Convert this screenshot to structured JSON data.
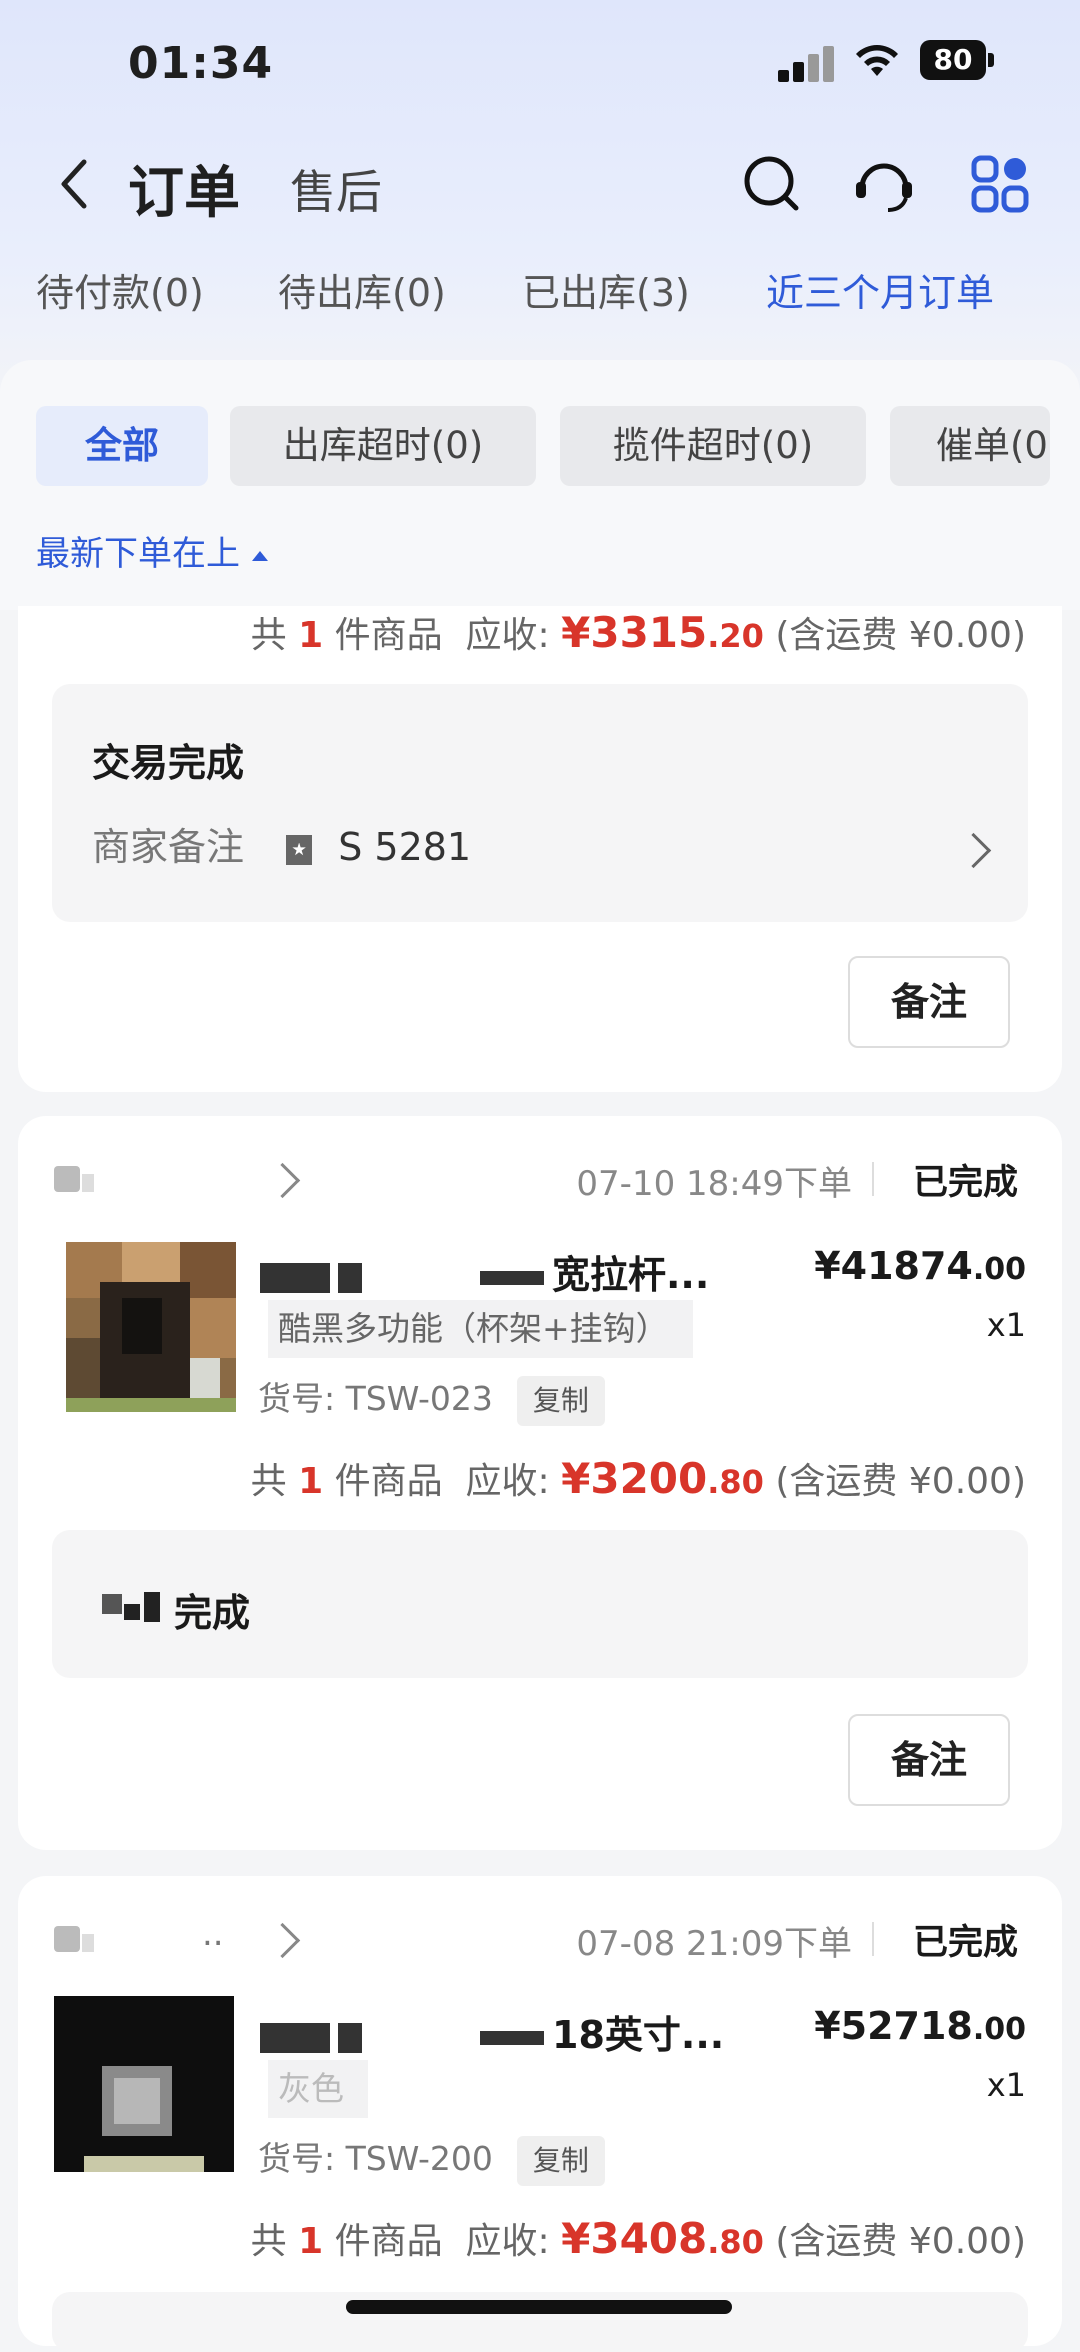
{
  "status_bar": {
    "time": "01:34",
    "battery": "80"
  },
  "header": {
    "title": "订单",
    "after_sale": "售后"
  },
  "tabs": [
    "待付款(0)",
    "待出库(0)",
    "已出库(3)",
    "近三个月订单"
  ],
  "active_tab": 3,
  "filters": [
    "全部",
    "出库超时(0)",
    "揽件超时(0)",
    "催单(0"
  ],
  "sort_label": "最新下单在上",
  "orders": [
    {
      "summary": {
        "prefix": "共",
        "count": "1",
        "unit": "件商品",
        "receivable_label": "应收:",
        "amount_int": "¥3315",
        "amount_dec": ".20",
        "shipping": "(含运费 ¥0.00)"
      },
      "status_title": "交易完成",
      "note_label": "商家备注",
      "note_value": "S        5281",
      "note_button": "备注"
    },
    {
      "shop_name": "",
      "time": "07-10 18:49下单",
      "status": "已完成",
      "product_title": "宽拉杆...",
      "price_int": "¥41874",
      "price_dec": ".00",
      "qty": "x1",
      "spec": "酷黑多功能（杯架+挂钩）",
      "sku": "货号: TSW-023",
      "copy": "复制",
      "summary": {
        "prefix": "共",
        "count": "1",
        "unit": "件商品",
        "receivable_label": "应收:",
        "amount_int": "¥3200",
        "amount_dec": ".80",
        "shipping": "(含运费 ¥0.00)"
      },
      "status_title": "完成",
      "note_button": "备注"
    },
    {
      "shop_name": "..",
      "time": "07-08 21:09下单",
      "status": "已完成",
      "product_title": "18英寸...",
      "price_int": "¥52718",
      "price_dec": ".00",
      "qty": "x1",
      "spec": "灰色",
      "sku": "货号: TSW-200",
      "copy": "复制",
      "summary": {
        "prefix": "共",
        "count": "1",
        "unit": "件商品",
        "receivable_label": "应收:",
        "amount_int": "¥3408",
        "amount_dec": ".80",
        "shipping": "(含运费 ¥0.00)"
      }
    }
  ],
  "colors": {
    "accent": "#2f5bd8",
    "price_red": "#d8352a"
  }
}
